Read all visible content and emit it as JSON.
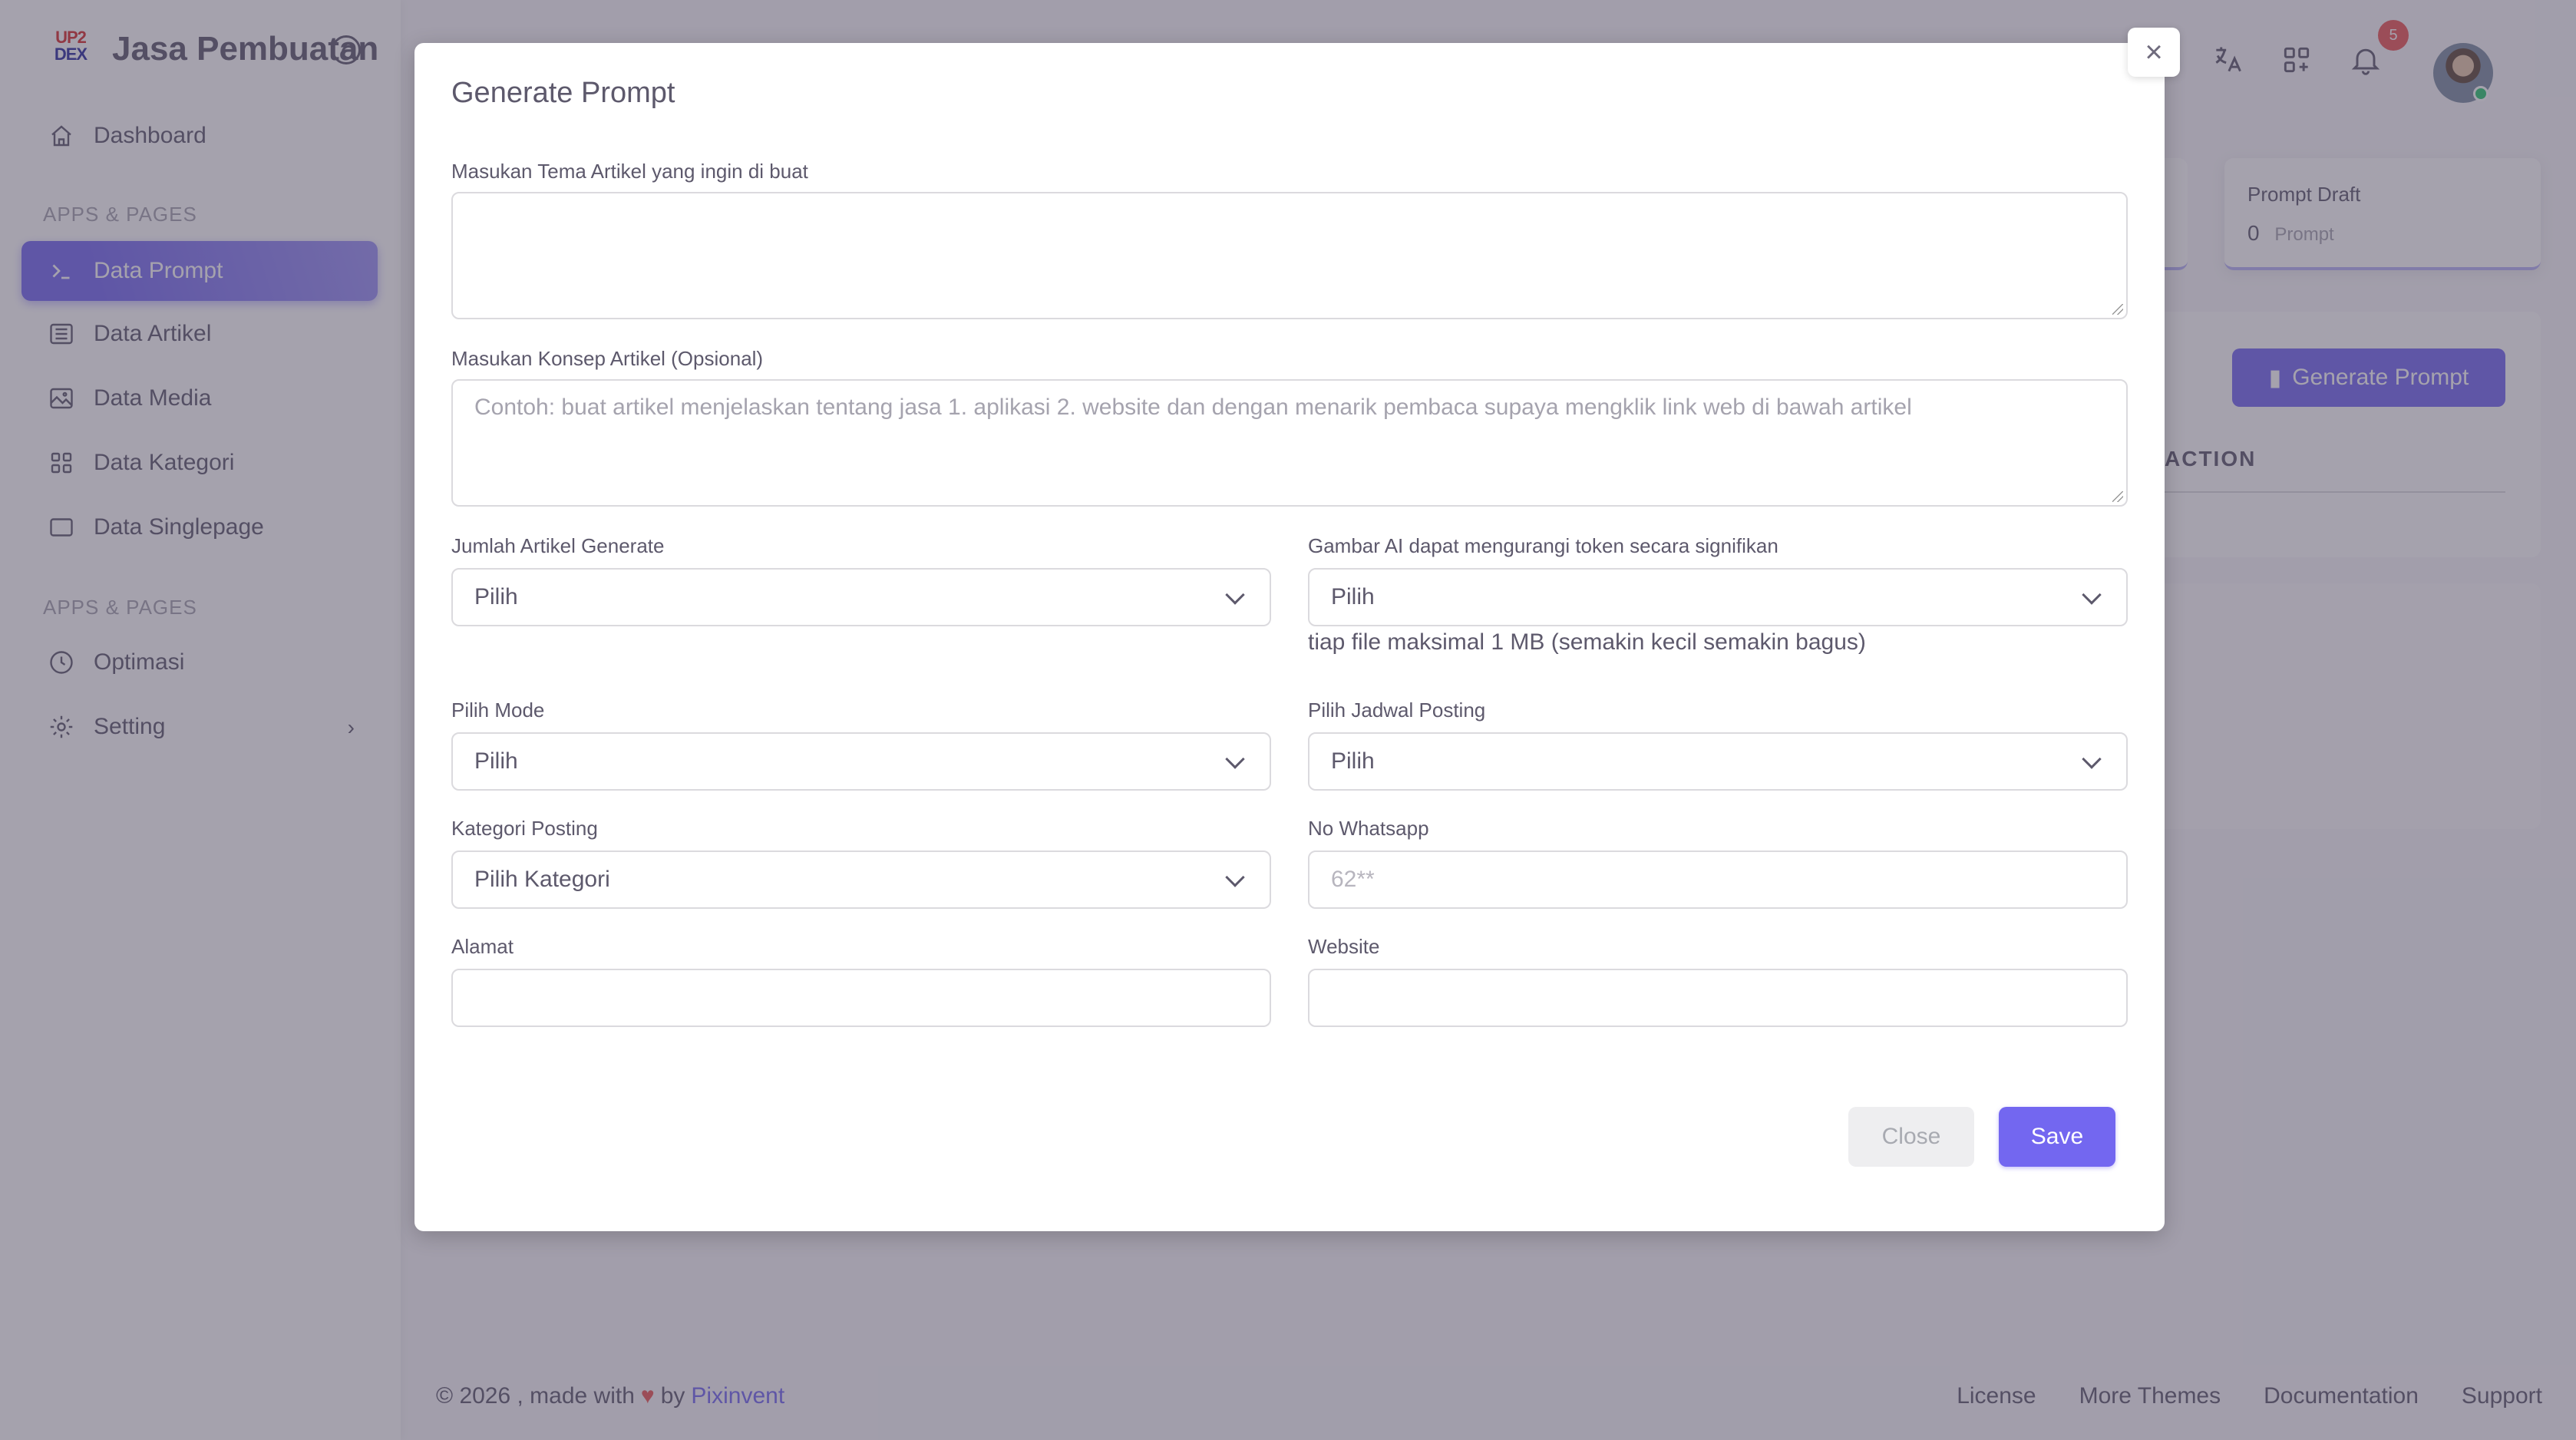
{
  "sidebar": {
    "brand_logo_top": "UP2",
    "brand_logo_bottom": "DEX",
    "brand_name": "Jasa Pembuatan",
    "items": [
      {
        "label": "Dashboard",
        "icon": "home-icon"
      },
      {
        "label": "Data Prompt",
        "icon": "terminal-icon",
        "active": true
      },
      {
        "label": "Data Artikel",
        "icon": "article-icon"
      },
      {
        "label": "Data Media",
        "icon": "photo-icon"
      },
      {
        "label": "Data Kategori",
        "icon": "category-icon"
      },
      {
        "label": "Data Singlepage",
        "icon": "page-icon"
      },
      {
        "label": "Optimasi",
        "icon": "clock-icon"
      },
      {
        "label": "Setting",
        "icon": "gear-icon"
      }
    ],
    "section_1": "APPS & PAGES",
    "section_2": "APPS & PAGES"
  },
  "topbar": {
    "notification_count": "5"
  },
  "stats": {
    "draft_title": "Prompt Draft",
    "draft_value": "0",
    "draft_unit": "Prompt"
  },
  "content": {
    "generate_button": "Generate Prompt",
    "table_action_header": "ACTION"
  },
  "footer": {
    "copyright": "© 2026 , made with",
    "by": "by",
    "brand": "Pixinvent",
    "links": [
      "License",
      "More Themes",
      "Documentation",
      "Support"
    ]
  },
  "modal": {
    "title": "Generate Prompt",
    "close_icon": "×",
    "tema_label": "Masukan Tema Artikel yang ingin di buat",
    "tema_value": "",
    "konsep_label": "Masukan Konsep Artikel (Opsional)",
    "konsep_placeholder": "Contoh: buat artikel menjelaskan tentang jasa 1. aplikasi 2. website dan dengan menarik pembaca supaya mengklik link web di bawah artikel",
    "jumlah_label": "Jumlah Artikel Generate",
    "jumlah_value": "Pilih",
    "gambar_label": "Gambar AI dapat mengurangi token secara signifikan",
    "gambar_value": "Pilih",
    "gambar_helper": "tiap file maksimal 1 MB (semakin kecil semakin bagus)",
    "mode_label": "Pilih Mode",
    "mode_value": "Pilih",
    "jadwal_label": "Pilih Jadwal Posting",
    "jadwal_value": "Pilih",
    "kategori_label": "Kategori Posting",
    "kategori_value": "Pilih Kategori",
    "whatsapp_label": "No Whatsapp",
    "whatsapp_placeholder": "62**",
    "alamat_label": "Alamat",
    "alamat_value": "",
    "website_label": "Website",
    "website_value": "",
    "close_button": "Close",
    "save_button": "Save"
  },
  "colors": {
    "primary": "#7367f0",
    "danger": "#ea5455",
    "success": "#28c76f"
  }
}
